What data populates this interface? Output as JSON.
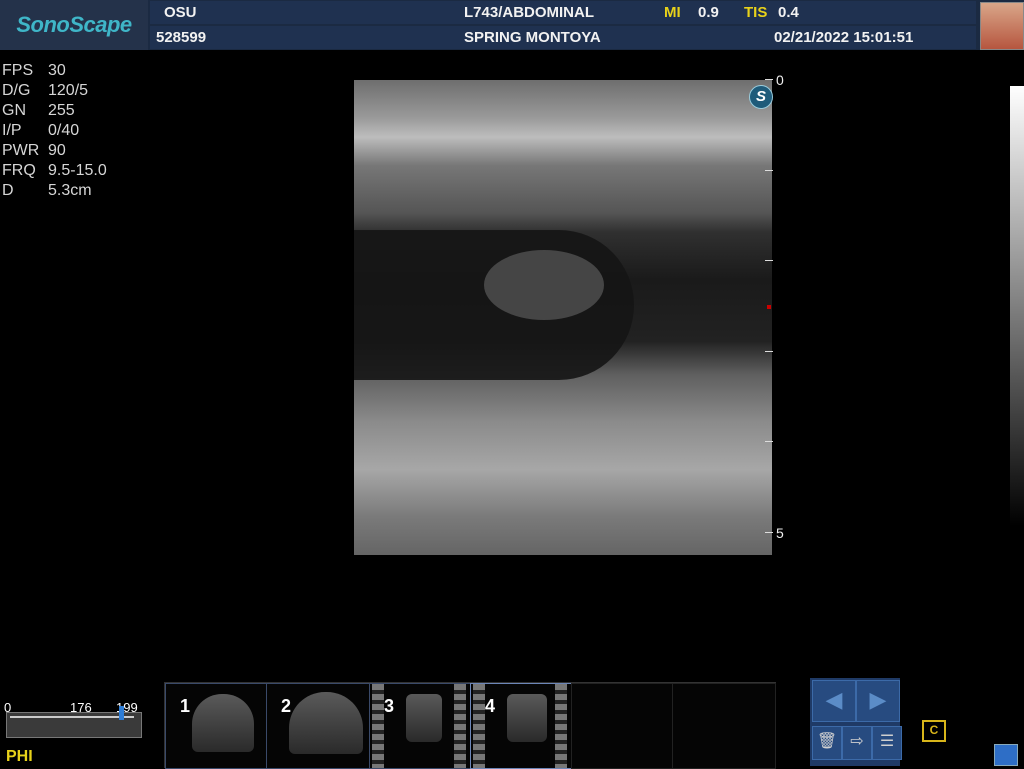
{
  "brand": {
    "name": "SonoScape"
  },
  "header": {
    "institution": "OSU",
    "probe_preset": "L743/ABDOMINAL",
    "mi_label": "MI",
    "mi_value": "0.9",
    "tis_label": "TIS",
    "tis_value": "0.4",
    "patient_id": "528599",
    "patient_name": "SPRING MONTOYA",
    "datetime": "02/21/2022 15:01:51"
  },
  "params": [
    {
      "key": "FPS",
      "value": "30"
    },
    {
      "key": "D/G",
      "value": "120/5"
    },
    {
      "key": "GN",
      "value": "255"
    },
    {
      "key": "I/P",
      "value": "0/40"
    },
    {
      "key": "PWR",
      "value": "90"
    },
    {
      "key": "FRQ",
      "value": "9.5-15.0"
    },
    {
      "key": "D",
      "value": "5.3cm"
    }
  ],
  "depth_scale": {
    "top": "0",
    "bottom": "5"
  },
  "image_badge": "S",
  "phi": {
    "label": "PHI",
    "min": "0",
    "current": "176",
    "max": "199",
    "level_fraction": 0.884
  },
  "thumbnails": [
    {
      "index": "1",
      "kind": "sector"
    },
    {
      "index": "2",
      "kind": "sector"
    },
    {
      "index": "3",
      "kind": "linear"
    },
    {
      "index": "4",
      "kind": "linear"
    }
  ],
  "nav": {
    "prev_icon": "chevron-left-icon",
    "next_icon": "chevron-right-icon"
  },
  "tools": [
    {
      "icon": "trash-icon"
    },
    {
      "icon": "export-icon"
    },
    {
      "icon": "checklist-icon"
    }
  ],
  "colors": {
    "accent_yellow": "#e8d21a",
    "header_bg": "#1f3150",
    "brand_teal": "#3fb6c8"
  }
}
